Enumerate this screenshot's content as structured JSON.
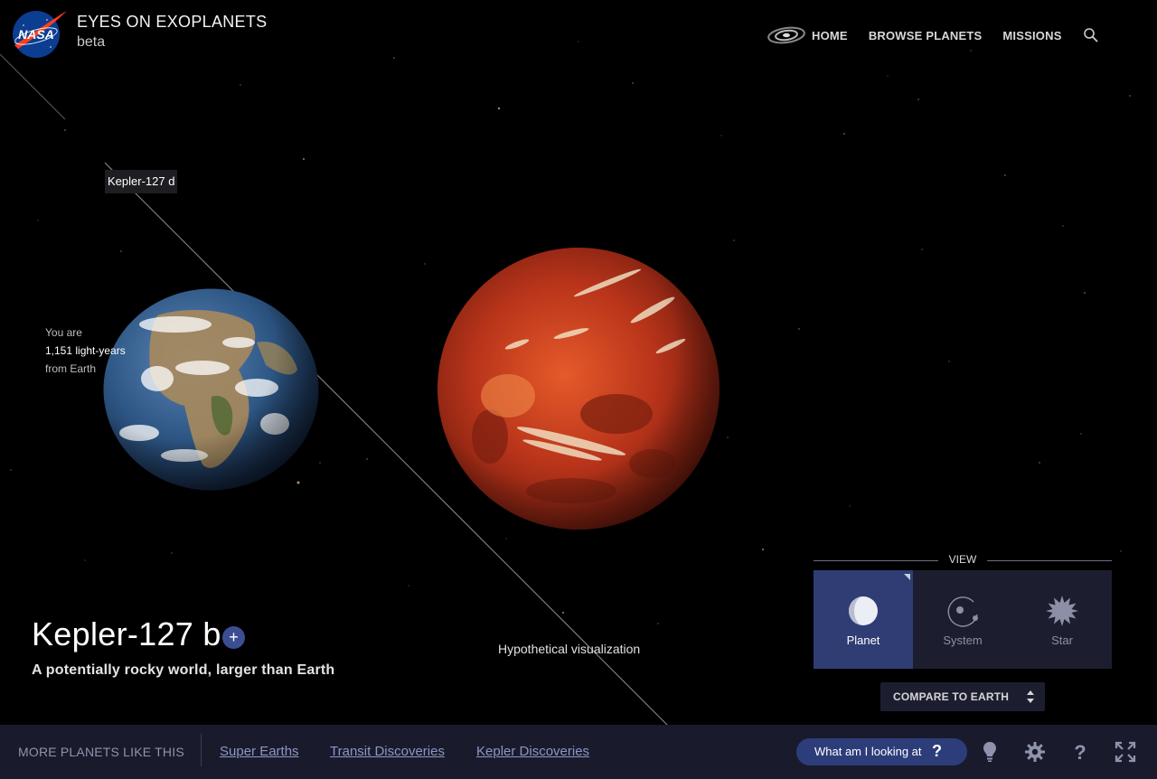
{
  "header": {
    "logo_text": "NASA",
    "title": "EYES ON EXOPLANETS",
    "subtitle": "beta",
    "nav": [
      {
        "label": "HOME",
        "icon": "galaxy-icon"
      },
      {
        "label": "BROWSE PLANETS"
      },
      {
        "label": "MISSIONS"
      }
    ],
    "search_icon": "search-icon"
  },
  "scene": {
    "orbit_label": "Kepler-127 d",
    "distance": {
      "line1": "You are",
      "line2": "1,151 light-years",
      "line3": "from Earth"
    },
    "caption": "Hypothetical visualization"
  },
  "planet": {
    "name": "Kepler-127 b",
    "add_label": "+",
    "description": "A potentially rocky world, larger than Earth"
  },
  "view": {
    "heading": "VIEW",
    "options": [
      {
        "label": "Planet",
        "icon": "planet-icon",
        "active": true
      },
      {
        "label": "System",
        "icon": "system-icon",
        "active": false
      },
      {
        "label": "Star",
        "icon": "star-icon",
        "active": false
      }
    ],
    "compare_label": "COMPARE TO EARTH"
  },
  "bottombar": {
    "more_label": "MORE PLANETS LIKE THIS",
    "links": [
      "Super Earths",
      "Transit Discoveries",
      "Kepler Discoveries"
    ],
    "help_label": "What am I looking at",
    "help_symbol": "?",
    "controls": [
      "lightbulb-icon",
      "gear-icon",
      "help-icon",
      "fullscreen-icon"
    ]
  },
  "colors": {
    "accent": "#3c4e93",
    "panel": "#1c1e30",
    "bar": "#191b2c",
    "link": "#8f95c4"
  }
}
